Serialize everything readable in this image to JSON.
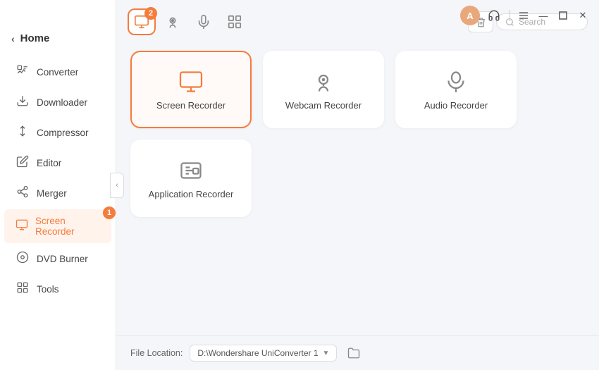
{
  "titlebar": {
    "avatar_label": "A",
    "headphone_icon": "🎧",
    "menu_icon": "☰",
    "minimize_icon": "—",
    "maximize_icon": "□",
    "close_icon": "✕"
  },
  "sidebar": {
    "back_label": "‹",
    "home_label": "Home",
    "items": [
      {
        "id": "converter",
        "label": "Converter",
        "icon": "⬇"
      },
      {
        "id": "downloader",
        "label": "Downloader",
        "icon": "⬇"
      },
      {
        "id": "compressor",
        "label": "Compressor",
        "icon": "📦"
      },
      {
        "id": "editor",
        "label": "Editor",
        "icon": "✂"
      },
      {
        "id": "merger",
        "label": "Merger",
        "icon": "🔗"
      },
      {
        "id": "screen-recorder",
        "label": "Screen Recorder",
        "icon": "🖥",
        "active": true,
        "badge": "1"
      },
      {
        "id": "dvd-burner",
        "label": "DVD Burner",
        "icon": "💿"
      },
      {
        "id": "tools",
        "label": "Tools",
        "icon": "⚙"
      }
    ]
  },
  "toolbar": {
    "tabs": [
      {
        "id": "screen",
        "icon": "screen",
        "active": true,
        "badge": "2"
      },
      {
        "id": "webcam",
        "icon": "webcam",
        "active": false
      },
      {
        "id": "audio",
        "icon": "audio",
        "active": false
      },
      {
        "id": "apps",
        "icon": "apps",
        "active": false
      }
    ],
    "delete_icon": "🗑",
    "search_placeholder": "Search"
  },
  "cards": {
    "row1": [
      {
        "id": "screen-recorder",
        "label": "Screen Recorder",
        "selected": true
      },
      {
        "id": "webcam-recorder",
        "label": "Webcam Recorder",
        "selected": false
      },
      {
        "id": "audio-recorder",
        "label": "Audio Recorder",
        "selected": false
      }
    ],
    "row2": [
      {
        "id": "application-recorder",
        "label": "Application Recorder",
        "selected": false
      }
    ]
  },
  "footer": {
    "label": "File Location:",
    "path": "D:\\Wondershare UniConverter 1",
    "dropdown_icon": "▼"
  }
}
